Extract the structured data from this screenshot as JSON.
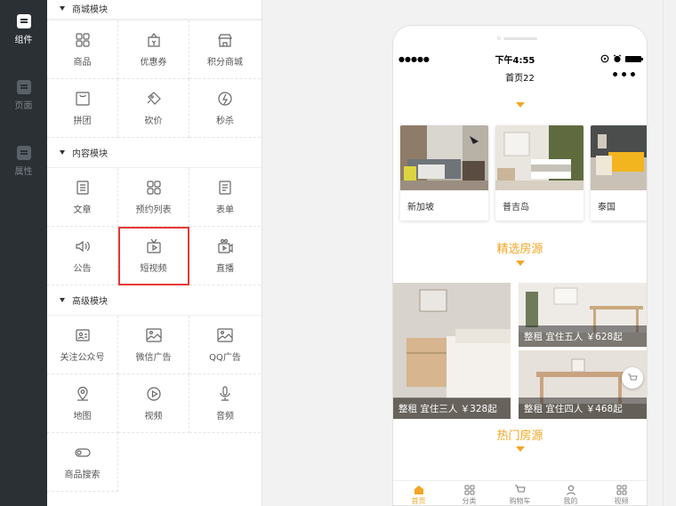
{
  "rail": {
    "items": [
      {
        "label": "组件",
        "icon": "component-icon",
        "active": true
      },
      {
        "label": "页面",
        "icon": "page-icon",
        "active": false
      },
      {
        "label": "属性",
        "icon": "property-icon",
        "active": false
      }
    ]
  },
  "panel": {
    "sections": [
      {
        "title": "商城模块",
        "items": [
          {
            "label": "商品",
            "icon": "grid-icon"
          },
          {
            "label": "优惠券",
            "icon": "coupon-icon"
          },
          {
            "label": "积分商城",
            "icon": "store-icon"
          },
          {
            "label": "拼团",
            "icon": "group-buy-icon"
          },
          {
            "label": "砍价",
            "icon": "bargain-icon"
          },
          {
            "label": "秒杀",
            "icon": "flash-sale-icon"
          }
        ]
      },
      {
        "title": "内容模块",
        "items": [
          {
            "label": "文章",
            "icon": "article-icon"
          },
          {
            "label": "预约列表",
            "icon": "grid-icon"
          },
          {
            "label": "表单",
            "icon": "form-icon"
          },
          {
            "label": "公告",
            "icon": "speaker-icon"
          },
          {
            "label": "短视频",
            "icon": "short-video-icon",
            "highlight": true
          },
          {
            "label": "直播",
            "icon": "live-icon"
          }
        ]
      },
      {
        "title": "高级模块",
        "items": [
          {
            "label": "关注公众号",
            "icon": "follow-account-icon"
          },
          {
            "label": "微信广告",
            "icon": "image-ad-icon"
          },
          {
            "label": "QQ广告",
            "icon": "image-ad-icon"
          },
          {
            "label": "地图",
            "icon": "map-pin-icon"
          },
          {
            "label": "视频",
            "icon": "play-icon"
          },
          {
            "label": "音频",
            "icon": "microphone-icon"
          },
          {
            "label": "商品搜索",
            "icon": "toggle-icon"
          }
        ]
      }
    ]
  },
  "phone": {
    "status": {
      "signal": "●●●●●",
      "time": "下午4:55"
    },
    "nav_title": "首页22",
    "nav_more": "•••",
    "destinations": [
      {
        "name": "新加坡"
      },
      {
        "name": "普吉岛"
      },
      {
        "name": "泰国"
      }
    ],
    "featured_title": "精选房源",
    "rooms": [
      {
        "caption": "整租 宜住三人 ￥328起"
      },
      {
        "caption": "整租 宜住五人 ￥628起"
      },
      {
        "caption": "整租 宜住四人 ￥468起"
      }
    ],
    "hot_title": "热门房源",
    "tabs": [
      {
        "label": "首页",
        "icon": "home-icon",
        "active": true
      },
      {
        "label": "分类",
        "icon": "category-icon",
        "active": false
      },
      {
        "label": "购物车",
        "icon": "cart-icon",
        "active": false
      },
      {
        "label": "我的",
        "icon": "user-icon",
        "active": false
      },
      {
        "label": "视频",
        "icon": "apps-icon",
        "active": false
      }
    ]
  },
  "colors": {
    "accent": "#f5a623",
    "rail_bg": "#2b3035",
    "highlight": "#e53935"
  }
}
